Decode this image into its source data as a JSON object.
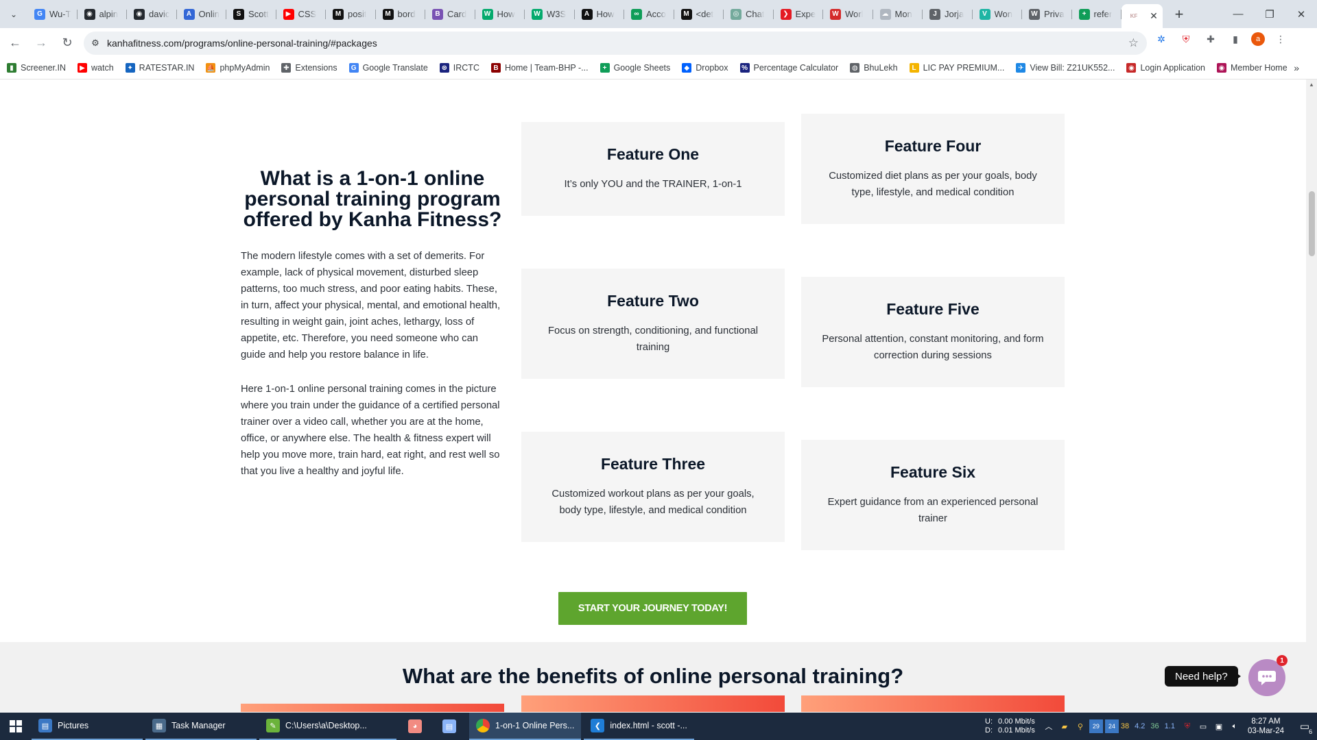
{
  "browser": {
    "tabs": [
      {
        "label": "Wu-T",
        "icon": "google-icon",
        "color": "#4285f4",
        "glyph": "G"
      },
      {
        "label": "alpin",
        "icon": "github-icon",
        "color": "#24292f",
        "glyph": "◉"
      },
      {
        "label": "davic",
        "icon": "github-icon",
        "color": "#24292f",
        "glyph": "◉"
      },
      {
        "label": "Onlin",
        "icon": "onlinegdb-icon",
        "color": "#3367d6",
        "glyph": "A"
      },
      {
        "label": "Scott",
        "icon": "scott-icon",
        "color": "#111111",
        "glyph": "S"
      },
      {
        "label": "CSS",
        "icon": "youtube-icon",
        "color": "#ff0000",
        "glyph": "▶"
      },
      {
        "label": "posit",
        "icon": "medium-icon",
        "color": "#111111",
        "glyph": "M"
      },
      {
        "label": "bord",
        "icon": "medium-icon",
        "color": "#111111",
        "glyph": "M"
      },
      {
        "label": "Card",
        "icon": "bootstrap-icon",
        "color": "#7952b3",
        "glyph": "B"
      },
      {
        "label": "How",
        "icon": "w3-icon",
        "color": "#04aa6d",
        "glyph": "W"
      },
      {
        "label": "W3S",
        "icon": "w3-icon",
        "color": "#04aa6d",
        "glyph": "W"
      },
      {
        "label": "How",
        "icon": "a-icon",
        "color": "#111111",
        "glyph": "A"
      },
      {
        "label": "Acco",
        "icon": "link-icon",
        "color": "#0f9d58",
        "glyph": "∞"
      },
      {
        "label": "<det",
        "icon": "medium-icon",
        "color": "#111111",
        "glyph": "M"
      },
      {
        "label": "Chat",
        "icon": "chatgpt-icon",
        "color": "#74aa9c",
        "glyph": "◎"
      },
      {
        "label": "Expe",
        "icon": "expe-icon",
        "color": "#e41b23",
        "glyph": "❯"
      },
      {
        "label": "Worl",
        "icon": "worl-icon",
        "color": "#d42a2a",
        "glyph": "W"
      },
      {
        "label": "Mon",
        "icon": "cloud-icon",
        "color": "#b0b7c0",
        "glyph": "☁"
      },
      {
        "label": "Jorja",
        "icon": "script-icon",
        "color": "#5f6368",
        "glyph": "J"
      },
      {
        "label": "Won",
        "icon": "vuetify-icon",
        "color": "#1eb5a4",
        "glyph": "V"
      },
      {
        "label": "Priva",
        "icon": "wiki-icon",
        "color": "#5f6368",
        "glyph": "W"
      },
      {
        "label": "refer",
        "icon": "sheets-icon",
        "color": "#0f9d58",
        "glyph": "+"
      }
    ],
    "active_tab": {
      "label": "KF",
      "icon": "kanha-icon"
    },
    "url": "kanhafitness.com/programs/online-personal-training/#packages",
    "avatar_letter": "a",
    "bookmarks": [
      {
        "label": "Screener.IN",
        "icon": "bar-chart-icon",
        "color": "#2e7d32",
        "glyph": "▮"
      },
      {
        "label": "watch",
        "icon": "youtube-icon",
        "color": "#ff0000",
        "glyph": "▶"
      },
      {
        "label": "RATESTAR.IN",
        "icon": "ratestar-icon",
        "color": "#1565c0",
        "glyph": "✦"
      },
      {
        "label": "phpMyAdmin",
        "icon": "phpmyadmin-icon",
        "color": "#f29111",
        "glyph": "⛵"
      },
      {
        "label": "Extensions",
        "icon": "puzzle-icon",
        "color": "#5f6368",
        "glyph": "✚"
      },
      {
        "label": "Google Translate",
        "icon": "translate-icon",
        "color": "#4285f4",
        "glyph": "G"
      },
      {
        "label": "IRCTC",
        "icon": "irctc-icon",
        "color": "#1a237e",
        "glyph": "⊛"
      },
      {
        "label": "Home | Team-BHP -...",
        "icon": "teambhp-icon",
        "color": "#8b0000",
        "glyph": "B"
      },
      {
        "label": "Google Sheets",
        "icon": "sheets-icon",
        "color": "#0f9d58",
        "glyph": "+"
      },
      {
        "label": "Dropbox",
        "icon": "dropbox-icon",
        "color": "#0061fe",
        "glyph": "◆"
      },
      {
        "label": "Percentage Calculator",
        "icon": "calculator-icon",
        "color": "#1a237e",
        "glyph": "%"
      },
      {
        "label": "BhuLekh",
        "icon": "globe-icon",
        "color": "#5f6368",
        "glyph": "◍"
      },
      {
        "label": "LIC PAY PREMIUM...",
        "icon": "lic-icon",
        "color": "#f4b400",
        "glyph": "L"
      },
      {
        "label": "View Bill: Z21UK552...",
        "icon": "bill-icon",
        "color": "#1e88e5",
        "glyph": "✈"
      },
      {
        "label": "Login Application",
        "icon": "login-icon",
        "color": "#c62828",
        "glyph": "◉"
      },
      {
        "label": "Member Home",
        "icon": "member-icon",
        "color": "#ad1457",
        "glyph": "◉"
      }
    ]
  },
  "page": {
    "intro_title": "What is a 1-on-1 online personal training program offered by Kanha Fitness?",
    "intro_p1": "The modern lifestyle comes with a set of demerits. For example, lack of physical movement, disturbed sleep patterns, too much stress, and poor eating habits. These, in turn, affect your physical, mental, and emotional health, resulting in weight gain, joint aches, lethargy, loss of appetite, etc. Therefore, you need someone who can guide and help you restore balance in life.",
    "intro_p2": "Here 1-on-1 online personal training comes in the picture where you train under the guidance of a certified personal trainer over a video call, whether you are at the home, office, or anywhere else. The health & fitness expert will help you move more, train hard, eat right, and rest well so that you live a healthy and joyful life.",
    "features": [
      {
        "title": "Feature One",
        "text": "It’s only YOU and the TRAINER, 1-on-1"
      },
      {
        "title": "Feature Two",
        "text": "Focus on strength, conditioning, and functional training"
      },
      {
        "title": "Feature Three",
        "text": "Customized workout plans as per your goals, body type, lifestyle, and medical condition"
      },
      {
        "title": "Feature Four",
        "text": "Customized diet plans as per your goals, body type, lifestyle, and medical condition"
      },
      {
        "title": "Feature Five",
        "text": "Personal attention, constant monitoring, and form correction during sessions"
      },
      {
        "title": "Feature Six",
        "text": "Expert guidance from an experienced personal trainer"
      }
    ],
    "cta_label": "START YOUR JOURNEY TODAY!",
    "benefits_title": "What are the benefits of online personal training?",
    "help_label": "Need help?",
    "help_badge": "1"
  },
  "taskbar": {
    "items": [
      {
        "label": "Pictures",
        "icon": "folder-icon",
        "color": "#3b78c4",
        "glyph": "▤"
      },
      {
        "label": "Task Manager",
        "icon": "task-manager-icon",
        "color": "#4a6a8a",
        "glyph": "▦"
      },
      {
        "label": "C:\\Users\\a\\Desktop...",
        "icon": "notepadpp-icon",
        "color": "#6bb33b",
        "glyph": "✎"
      }
    ],
    "icon_only": [
      {
        "icon": "app-icon",
        "color": "#f28b82",
        "glyph": "◕"
      },
      {
        "icon": "notepad-icon",
        "color": "#8ab4f8",
        "glyph": "▤"
      }
    ],
    "chrome_task": {
      "label": "1-on-1 Online Pers...",
      "icon": "chrome-icon"
    },
    "vscode_task": {
      "label": "index.html - scott -...",
      "icon": "vscode-icon"
    },
    "net_up_label": "U:",
    "net_down_label": "D:",
    "net_up": "0.00 Mbit/s",
    "net_down": "0.01 Mbit/s",
    "tray_nums": [
      "38",
      "4.2",
      "36",
      "1.1"
    ],
    "time": "8:27 AM",
    "date": "03-Mar-24",
    "notif_count": "6"
  },
  "colors": {
    "accent_green": "#5ea52e",
    "heading": "#0b1728",
    "card_bg": "#f5f5f5",
    "help_purple": "#b98ac4"
  }
}
